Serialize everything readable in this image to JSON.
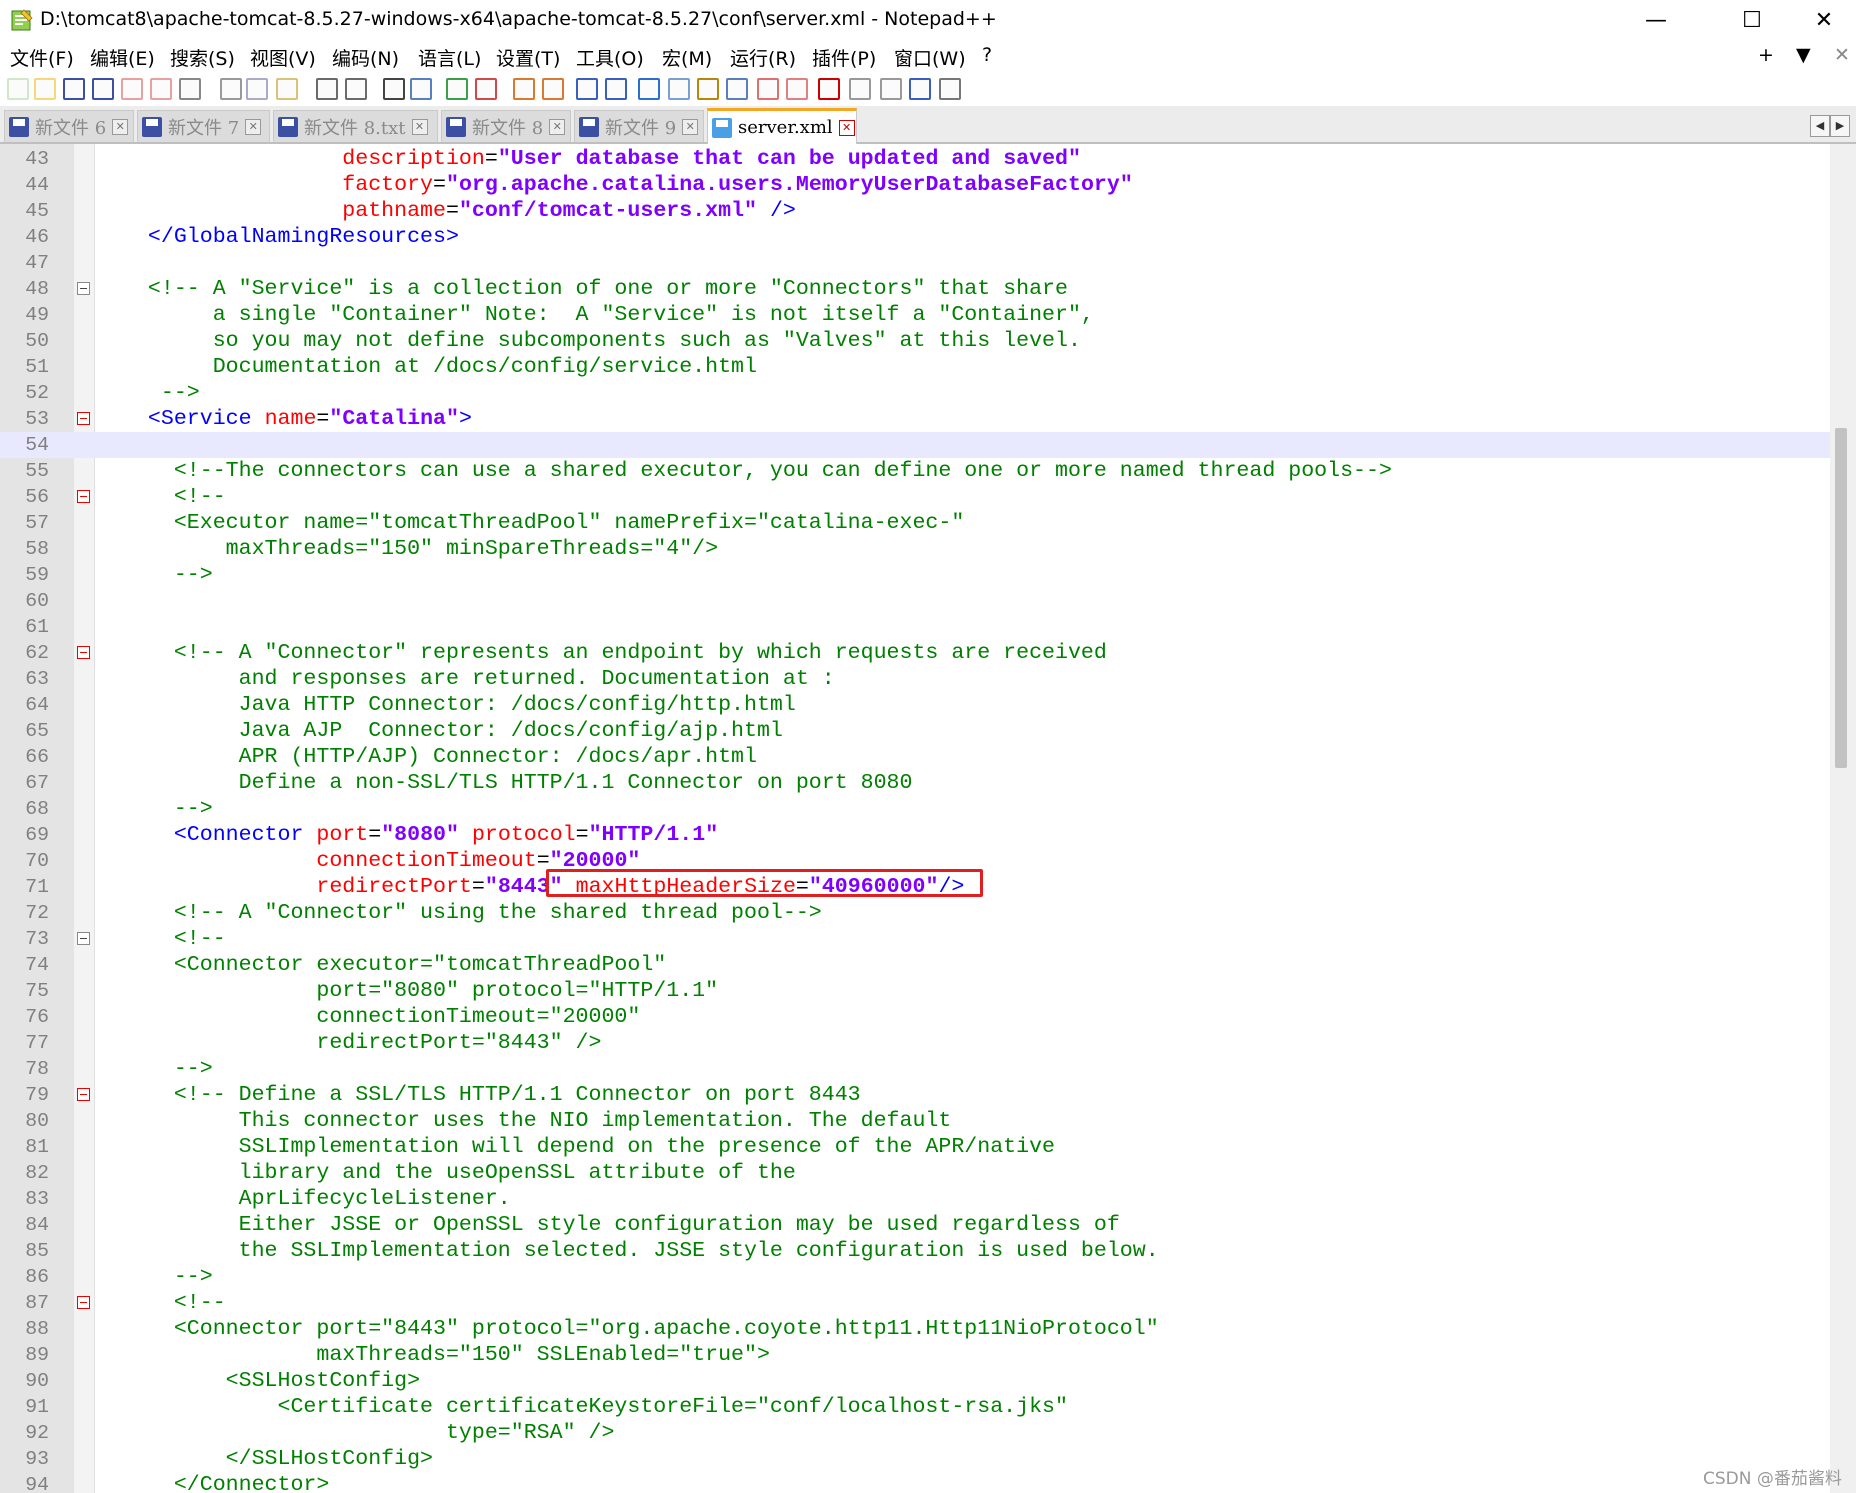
{
  "window": {
    "title": "D:\\tomcat8\\apache-tomcat-8.5.27-windows-x64\\apache-tomcat-8.5.27\\conf\\server.xml - Notepad++",
    "controls": [
      "—",
      "☐",
      "✕"
    ]
  },
  "menubar": {
    "items": [
      "文件(F)",
      "编辑(E)",
      "搜索(S)",
      "视图(V)",
      "编码(N)",
      "语言(L)",
      "设置(T)",
      "工具(O)",
      "宏(M)",
      "运行(R)",
      "插件(P)",
      "窗口(W)",
      "?"
    ],
    "right": [
      "+",
      "▼",
      "✕"
    ]
  },
  "toolbar": {
    "icons": [
      "new-file-icon",
      "open-file-icon",
      "save-icon",
      "save-all-icon",
      "close-icon",
      "close-all-icon",
      "print-icon",
      "cut-icon",
      "copy-icon",
      "paste-icon",
      "undo-icon",
      "redo-icon",
      "find-icon",
      "replace-icon",
      "zoom-in-icon",
      "zoom-out-icon",
      "sync-v-icon",
      "sync-h-icon",
      "word-wrap-icon",
      "show-all-chars-icon",
      "indent-guide-icon",
      "udl-icon",
      "doc-map-icon",
      "function-list-icon",
      "folder-workspace-icon",
      "monitor-icon",
      "record-macro-icon",
      "stop-record-icon",
      "play-macro-icon",
      "run-macro-multiple-icon",
      "save-macro-icon"
    ]
  },
  "tabs": [
    {
      "label": "新文件 6",
      "active": false
    },
    {
      "label": "新文件 7",
      "active": false
    },
    {
      "label": "新文件 8.txt",
      "active": false
    },
    {
      "label": "新文件 8",
      "active": false
    },
    {
      "label": "新文件 9",
      "active": false
    },
    {
      "label": "server.xml",
      "active": true
    }
  ],
  "tab_nav": [
    "◀",
    "▶"
  ],
  "editor": {
    "current_line": 54,
    "lines": [
      {
        "n": "43",
        "fold": "",
        "tokens": [
          [
            "",
            "                 "
          ],
          [
            "a",
            "description"
          ],
          [
            "",
            "="
          ],
          [
            "v",
            "\"User database that can be updated and saved\""
          ]
        ]
      },
      {
        "n": "44",
        "fold": "",
        "tokens": [
          [
            "",
            "                 "
          ],
          [
            "a",
            "factory"
          ],
          [
            "",
            "="
          ],
          [
            "v",
            "\"org.apache.catalina.users.MemoryUserDatabaseFactory\""
          ]
        ]
      },
      {
        "n": "45",
        "fold": "",
        "tokens": [
          [
            "",
            "                 "
          ],
          [
            "a",
            "pathname"
          ],
          [
            "",
            "="
          ],
          [
            "v",
            "\"conf/tomcat-users.xml\""
          ],
          [
            "t",
            " />"
          ]
        ]
      },
      {
        "n": "46",
        "fold": "",
        "tokens": [
          [
            "",
            "  "
          ],
          [
            "t",
            "</GlobalNamingResources>"
          ]
        ]
      },
      {
        "n": "47",
        "fold": "",
        "tokens": []
      },
      {
        "n": "48",
        "fold": "gray",
        "tokens": [
          [
            "",
            "  "
          ],
          [
            "c",
            "<!-- A \"Service\" is a collection of one or more \"Connectors\" that share"
          ]
        ]
      },
      {
        "n": "49",
        "fold": "",
        "tokens": [
          [
            "c",
            "       a single \"Container\" Note:  A \"Service\" is not itself a \"Container\","
          ]
        ]
      },
      {
        "n": "50",
        "fold": "",
        "tokens": [
          [
            "c",
            "       so you may not define subcomponents such as \"Valves\" at this level."
          ]
        ]
      },
      {
        "n": "51",
        "fold": "",
        "tokens": [
          [
            "c",
            "       Documentation at /docs/config/service.html"
          ]
        ]
      },
      {
        "n": "52",
        "fold": "",
        "tokens": [
          [
            "c",
            "   -->"
          ]
        ]
      },
      {
        "n": "53",
        "fold": "red",
        "tokens": [
          [
            "",
            "  "
          ],
          [
            "t",
            "<Service "
          ],
          [
            "a",
            "name"
          ],
          [
            "",
            "="
          ],
          [
            "v",
            "\"Catalina\""
          ],
          [
            "t",
            ">"
          ]
        ]
      },
      {
        "n": "54",
        "fold": "",
        "tokens": []
      },
      {
        "n": "55",
        "fold": "",
        "tokens": [
          [
            "c",
            "    <!--The connectors can use a shared executor, you can define one or more named thread pools-->"
          ]
        ]
      },
      {
        "n": "56",
        "fold": "red",
        "tokens": [
          [
            "c",
            "    <!--"
          ]
        ]
      },
      {
        "n": "57",
        "fold": "",
        "tokens": [
          [
            "c",
            "    <Executor name=\"tomcatThreadPool\" namePrefix=\"catalina-exec-\""
          ]
        ]
      },
      {
        "n": "58",
        "fold": "",
        "tokens": [
          [
            "c",
            "        maxThreads=\"150\" minSpareThreads=\"4\"/>"
          ]
        ]
      },
      {
        "n": "59",
        "fold": "",
        "tokens": [
          [
            "c",
            "    -->"
          ]
        ]
      },
      {
        "n": "60",
        "fold": "",
        "tokens": []
      },
      {
        "n": "61",
        "fold": "",
        "tokens": []
      },
      {
        "n": "62",
        "fold": "red",
        "tokens": [
          [
            "c",
            "    <!-- A \"Connector\" represents an endpoint by which requests are received"
          ]
        ]
      },
      {
        "n": "63",
        "fold": "",
        "tokens": [
          [
            "c",
            "         and responses are returned. Documentation at :"
          ]
        ]
      },
      {
        "n": "64",
        "fold": "",
        "tokens": [
          [
            "c",
            "         Java HTTP Connector: /docs/config/http.html"
          ]
        ]
      },
      {
        "n": "65",
        "fold": "",
        "tokens": [
          [
            "c",
            "         Java AJP  Connector: /docs/config/ajp.html"
          ]
        ]
      },
      {
        "n": "66",
        "fold": "",
        "tokens": [
          [
            "c",
            "         APR (HTTP/AJP) Connector: /docs/apr.html"
          ]
        ]
      },
      {
        "n": "67",
        "fold": "",
        "tokens": [
          [
            "c",
            "         Define a non-SSL/TLS HTTP/1.1 Connector on port 8080"
          ]
        ]
      },
      {
        "n": "68",
        "fold": "",
        "tokens": [
          [
            "c",
            "    -->"
          ]
        ]
      },
      {
        "n": "69",
        "fold": "",
        "tokens": [
          [
            "",
            "    "
          ],
          [
            "t",
            "<Connector "
          ],
          [
            "a",
            "port"
          ],
          [
            "",
            "="
          ],
          [
            "v",
            "\"8080\""
          ],
          [
            "",
            " "
          ],
          [
            "a",
            "protocol"
          ],
          [
            "",
            "="
          ],
          [
            "v",
            "\"HTTP/1.1\""
          ]
        ]
      },
      {
        "n": "70",
        "fold": "",
        "tokens": [
          [
            "",
            "               "
          ],
          [
            "a",
            "connectionTimeout"
          ],
          [
            "",
            "="
          ],
          [
            "v",
            "\"20000\""
          ]
        ]
      },
      {
        "n": "71",
        "fold": "",
        "tokens": [
          [
            "",
            "               "
          ],
          [
            "a",
            "redirectPort"
          ],
          [
            "",
            "="
          ],
          [
            "v",
            "\"8443\""
          ],
          [
            "",
            " "
          ],
          [
            "a",
            "maxHttpHeaderSize"
          ],
          [
            "",
            "="
          ],
          [
            "v",
            "\"40960000\""
          ],
          [
            "t",
            "/>"
          ]
        ]
      },
      {
        "n": "72",
        "fold": "",
        "tokens": [
          [
            "c",
            "    <!-- A \"Connector\" using the shared thread pool-->"
          ]
        ]
      },
      {
        "n": "73",
        "fold": "gray",
        "tokens": [
          [
            "c",
            "    <!--"
          ]
        ]
      },
      {
        "n": "74",
        "fold": "",
        "tokens": [
          [
            "c",
            "    <Connector executor=\"tomcatThreadPool\""
          ]
        ]
      },
      {
        "n": "75",
        "fold": "",
        "tokens": [
          [
            "c",
            "               port=\"8080\" protocol=\"HTTP/1.1\""
          ]
        ]
      },
      {
        "n": "76",
        "fold": "",
        "tokens": [
          [
            "c",
            "               connectionTimeout=\"20000\""
          ]
        ]
      },
      {
        "n": "77",
        "fold": "",
        "tokens": [
          [
            "c",
            "               redirectPort=\"8443\" />"
          ]
        ]
      },
      {
        "n": "78",
        "fold": "",
        "tokens": [
          [
            "c",
            "    -->"
          ]
        ]
      },
      {
        "n": "79",
        "fold": "red",
        "tokens": [
          [
            "c",
            "    <!-- Define a SSL/TLS HTTP/1.1 Connector on port 8443"
          ]
        ]
      },
      {
        "n": "80",
        "fold": "",
        "tokens": [
          [
            "c",
            "         This connector uses the NIO implementation. The default"
          ]
        ]
      },
      {
        "n": "81",
        "fold": "",
        "tokens": [
          [
            "c",
            "         SSLImplementation will depend on the presence of the APR/native"
          ]
        ]
      },
      {
        "n": "82",
        "fold": "",
        "tokens": [
          [
            "c",
            "         library and the useOpenSSL attribute of the"
          ]
        ]
      },
      {
        "n": "83",
        "fold": "",
        "tokens": [
          [
            "c",
            "         AprLifecycleListener."
          ]
        ]
      },
      {
        "n": "84",
        "fold": "",
        "tokens": [
          [
            "c",
            "         Either JSSE or OpenSSL style configuration may be used regardless of"
          ]
        ]
      },
      {
        "n": "85",
        "fold": "",
        "tokens": [
          [
            "c",
            "         the SSLImplementation selected. JSSE style configuration is used below."
          ]
        ]
      },
      {
        "n": "86",
        "fold": "",
        "tokens": [
          [
            "c",
            "    -->"
          ]
        ]
      },
      {
        "n": "87",
        "fold": "red",
        "tokens": [
          [
            "c",
            "    <!--"
          ]
        ]
      },
      {
        "n": "88",
        "fold": "",
        "tokens": [
          [
            "c",
            "    <Connector port=\"8443\" protocol=\"org.apache.coyote.http11.Http11NioProtocol\""
          ]
        ]
      },
      {
        "n": "89",
        "fold": "",
        "tokens": [
          [
            "c",
            "               maxThreads=\"150\" SSLEnabled=\"true\">"
          ]
        ]
      },
      {
        "n": "90",
        "fold": "",
        "tokens": [
          [
            "c",
            "        <SSLHostConfig>"
          ]
        ]
      },
      {
        "n": "91",
        "fold": "",
        "tokens": [
          [
            "c",
            "            <Certificate certificateKeystoreFile=\"conf/localhost-rsa.jks\""
          ]
        ]
      },
      {
        "n": "92",
        "fold": "",
        "tokens": [
          [
            "c",
            "                         type=\"RSA\" />"
          ]
        ]
      },
      {
        "n": "93",
        "fold": "",
        "tokens": [
          [
            "c",
            "        </SSLHostConfig>"
          ]
        ]
      },
      {
        "n": "94",
        "fold": "",
        "tokens": [
          [
            "c",
            "    </Connector>"
          ]
        ]
      }
    ]
  },
  "watermark": "CSDN @番茄酱料",
  "colors": {
    "comment": "#008000",
    "tag": "#0000ff",
    "attribute": "#ff0000",
    "value": "#8000ff",
    "highlight_box": "#e02020",
    "active_tab_accent": "#f5a623"
  }
}
